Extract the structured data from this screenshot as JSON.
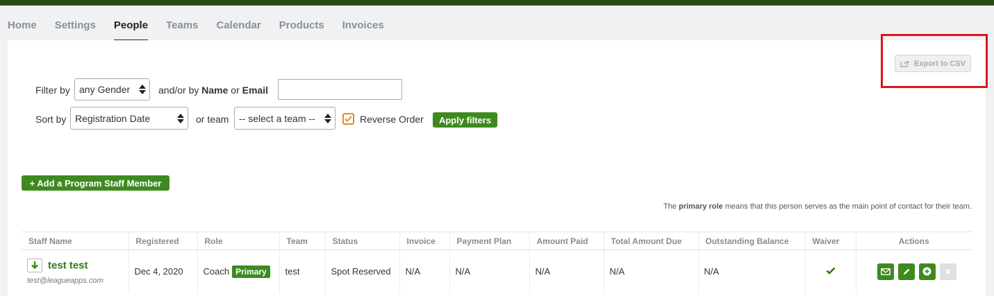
{
  "nav": {
    "tabs": [
      {
        "label": "Home"
      },
      {
        "label": "Settings"
      },
      {
        "label": "People"
      },
      {
        "label": "Teams"
      },
      {
        "label": "Calendar"
      },
      {
        "label": "Products"
      },
      {
        "label": "Invoices"
      }
    ],
    "active": "People"
  },
  "toolbar": {
    "export_label": "Export to CSV"
  },
  "filters": {
    "filter_by_label": "Filter by",
    "gender_value": "any Gender",
    "andor_prefix": "and/or by",
    "name_word": "Name",
    "or_word": "or",
    "email_word": "Email",
    "name_email_value": "",
    "sort_by_label": "Sort by",
    "sort_value": "Registration Date",
    "or_team_label": "or team",
    "team_value": "-- select a team --",
    "reverse_order_label": "Reverse Order",
    "reverse_order_checked": true,
    "apply_label": "Apply filters"
  },
  "add_staff_label": "+ Add a Program Staff Member",
  "note": {
    "prefix": "The",
    "bold": "primary role",
    "suffix": "means that this person serves as the main point of contact for their team."
  },
  "table": {
    "headers": [
      "Staff Name",
      "Registered",
      "Role",
      "Team",
      "Status",
      "Invoice",
      "Payment Plan",
      "Amount Paid",
      "Total Amount Due",
      "Outstanding Balance",
      "Waiver",
      "Actions"
    ],
    "rows": [
      {
        "name": "test test",
        "email": "test@leagueapps.com",
        "registered": "Dec 4, 2020",
        "role": "Coach",
        "role_badge": "Primary",
        "team": "test",
        "status": "Spot Reserved",
        "invoice": "N/A",
        "payment_plan": "N/A",
        "amount_paid": "N/A",
        "total_amount_due": "N/A",
        "outstanding_balance": "N/A",
        "waiver_signed": true
      }
    ]
  },
  "colors": {
    "brand_green": "#3e8a1f",
    "highlight_red": "#e0121c",
    "checkbox_orange": "#e7892a"
  }
}
